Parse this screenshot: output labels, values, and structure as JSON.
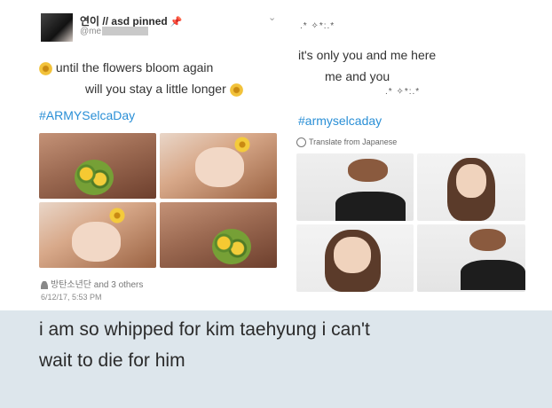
{
  "left_tweet": {
    "display_name": "연이 // asd pinned",
    "handle": "@me",
    "line1": "until the flowers bloom again",
    "line2": "will you stay a little longer",
    "hashtag": "#ARMYSelcaDay",
    "likes": "방탄소년단 and 3 others",
    "date": "6/12/17, 5:53 PM",
    "icons": [
      "avatar",
      "pin-icon",
      "chevron-down-icon",
      "sunflower-emoji",
      "person-icon"
    ]
  },
  "right_tweet": {
    "sparkle_top": ".* ✧*:.*",
    "line1": "it's only you and me here",
    "line2": "me and you",
    "sparkle_bottom": ".* ✧*:.*",
    "hashtag": "#armyselcaday",
    "translate": "Translate from Japanese",
    "icons": [
      "globe-icon"
    ]
  },
  "caption": {
    "line1": "i am so whipped for kim taehyung i can't",
    "line2": "wait to die for him",
    "background": "#dde6ec"
  },
  "colors": {
    "hashtag": "#2a8fd6",
    "pin": "#d23b3b"
  }
}
